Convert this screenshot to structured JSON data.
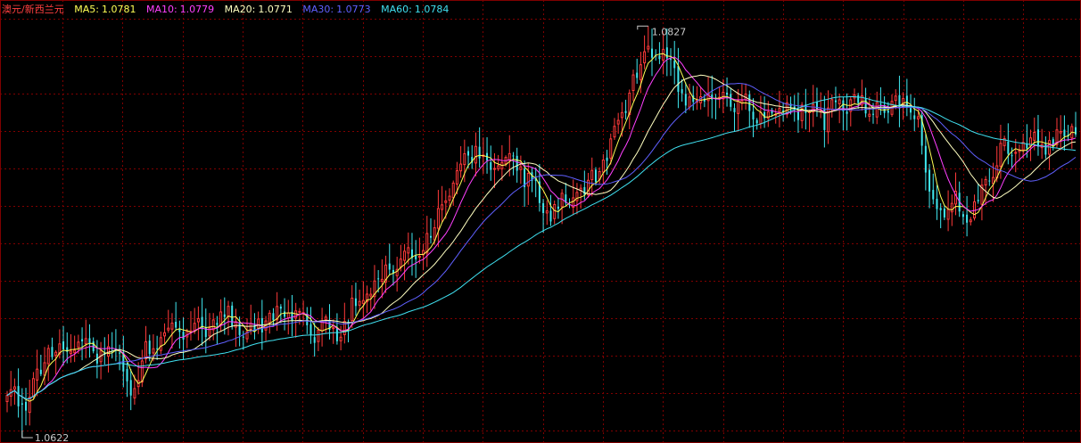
{
  "header": {
    "symbol": "澳元/新西兰元",
    "ma_items": [
      {
        "label": "MA5:",
        "value": "1.0781",
        "color": "#ffff55"
      },
      {
        "label": "MA10:",
        "value": "1.0779",
        "color": "#ff40ff"
      },
      {
        "label": "MA20:",
        "value": "1.0771",
        "color": "#ffffc0"
      },
      {
        "label": "MA30:",
        "value": "1.0773",
        "color": "#6060ff"
      },
      {
        "label": "MA60:",
        "value": "1.0784",
        "color": "#40e0f0"
      }
    ]
  },
  "colors": {
    "background": "#000000",
    "grid": "#800000",
    "up": "#ff3a3a",
    "down": "#40e8f0",
    "title": "#ff4040",
    "annotation": "#c8c8c8"
  },
  "chart_data": {
    "type": "candlestick",
    "title": "",
    "xlabel": "",
    "ylabel": "",
    "grid": true,
    "ylim": [
      1.0622,
      1.0832
    ],
    "annotations": {
      "high_label": "1.0827",
      "low_label": "1.0622"
    },
    "price_path": [
      [
        0,
        1.0643
      ],
      [
        4,
        1.0638
      ],
      [
        8,
        1.0651
      ],
      [
        12,
        1.0669
      ],
      [
        16,
        1.066
      ],
      [
        20,
        1.0675
      ],
      [
        24,
        1.0662
      ],
      [
        27,
        1.0666
      ],
      [
        30,
        1.066
      ],
      [
        33,
        1.0645
      ],
      [
        37,
        1.0663
      ],
      [
        40,
        1.0672
      ],
      [
        44,
        1.0677
      ],
      [
        47,
        1.067
      ],
      [
        50,
        1.068
      ],
      [
        53,
        1.0676
      ],
      [
        57,
        1.0684
      ],
      [
        60,
        1.0682
      ],
      [
        63,
        1.0672
      ],
      [
        67,
        1.0681
      ],
      [
        71,
        1.068
      ],
      [
        75,
        1.0688
      ],
      [
        78,
        1.0683
      ],
      [
        82,
        1.0676
      ],
      [
        85,
        1.0676
      ],
      [
        88,
        1.0673
      ],
      [
        92,
        1.0686
      ],
      [
        95,
        1.0692
      ],
      [
        99,
        1.0699
      ],
      [
        102,
        1.0706
      ],
      [
        106,
        1.0714
      ],
      [
        110,
        1.0712
      ],
      [
        113,
        1.0723
      ],
      [
        117,
        1.074
      ],
      [
        121,
        1.0759
      ],
      [
        125,
        1.0767
      ],
      [
        129,
        1.0758
      ],
      [
        133,
        1.0757
      ],
      [
        136,
        1.0758
      ],
      [
        140,
        1.0748
      ],
      [
        144,
        1.0733
      ],
      [
        148,
        1.0738
      ],
      [
        152,
        1.0743
      ],
      [
        156,
        1.0749
      ],
      [
        159,
        1.0759
      ],
      [
        163,
        1.078
      ],
      [
        167,
        1.08
      ],
      [
        171,
        1.0816
      ],
      [
        175,
        1.0812
      ],
      [
        179,
        1.08
      ],
      [
        183,
        1.0785
      ],
      [
        187,
        1.0795
      ],
      [
        191,
        1.0788
      ],
      [
        195,
        1.0791
      ],
      [
        199,
        1.0785
      ],
      [
        202,
        1.0783
      ],
      [
        205,
        1.0782
      ],
      [
        208,
        1.0789
      ],
      [
        211,
        1.078
      ],
      [
        215,
        1.0792
      ],
      [
        218,
        1.0777
      ],
      [
        221,
        1.0792
      ],
      [
        224,
        1.0785
      ],
      [
        228,
        1.079
      ],
      [
        232,
        1.0784
      ],
      [
        236,
        1.079
      ],
      [
        240,
        1.0788
      ],
      [
        243,
        1.0784
      ],
      [
        246,
        1.0742
      ],
      [
        250,
        1.0738
      ],
      [
        253,
        1.074
      ],
      [
        256,
        1.0732
      ],
      [
        259,
        1.0742
      ],
      [
        262,
        1.0754
      ],
      [
        265,
        1.0765
      ],
      [
        268,
        1.0765
      ],
      [
        272,
        1.0771
      ],
      [
        276,
        1.0767
      ],
      [
        279,
        1.077
      ],
      [
        282,
        1.0773
      ],
      [
        285,
        1.0778
      ]
    ],
    "series": [
      {
        "name": "MA5",
        "color": "#ffff55",
        "period": 5
      },
      {
        "name": "MA10",
        "color": "#ff40ff",
        "period": 10
      },
      {
        "name": "MA20",
        "color": "#ffffc0",
        "period": 20
      },
      {
        "name": "MA30",
        "color": "#6060ff",
        "period": 30
      },
      {
        "name": "MA60",
        "color": "#40e0f0",
        "period": 60
      }
    ],
    "candle_count": 286
  }
}
